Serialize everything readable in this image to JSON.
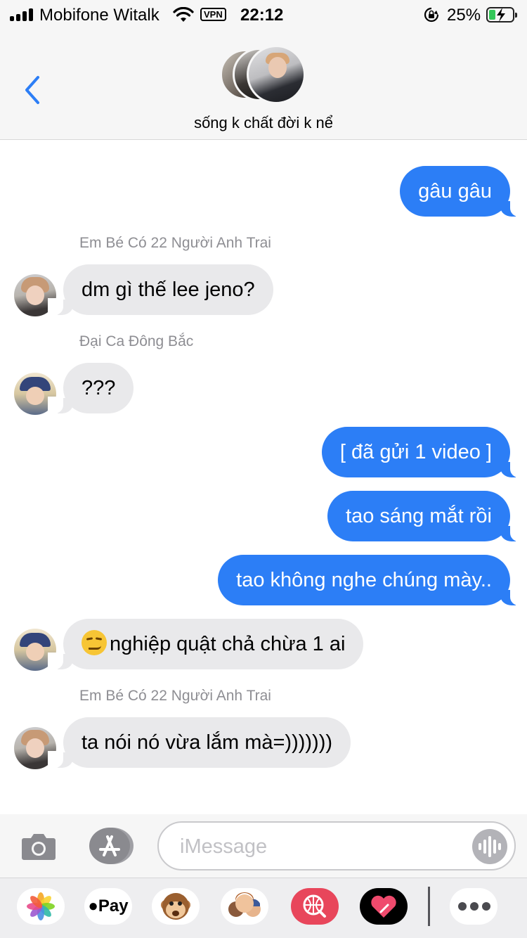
{
  "status_bar": {
    "carrier": "Mobifone Witalk",
    "vpn": "VPN",
    "time": "22:12",
    "battery": "25%",
    "battery_level": 0.25
  },
  "header": {
    "title": "sống k chất đời k nể"
  },
  "messages": [
    {
      "text": "gâu gâu"
    },
    {
      "sender": "Em Bé Có 22 Người Anh Trai",
      "text": "dm gì thế lee jeno?"
    },
    {
      "sender": "Đại Ca Đông Bắc",
      "text": "???"
    },
    {
      "text": "[ đã gửi 1 video ]"
    },
    {
      "text": "tao sáng mắt rồi"
    },
    {
      "text": "tao không nghe chúng mày.."
    },
    {
      "text": "nghiệp quật chả chừa 1 ai",
      "emoji": "smirking-face"
    },
    {
      "sender": "Em Bé Có 22 Người Anh Trai",
      "text": "ta nói nó vừa lắm mà=)))))))"
    }
  ],
  "compose": {
    "placeholder": "iMessage"
  },
  "drawer": {
    "pay_label": "Pay"
  },
  "colors": {
    "outgoing_bubble": "#2c7ef6",
    "incoming_bubble": "#e9e9eb",
    "accent": "#2c7ef6"
  },
  "icons": [
    "signal-icon",
    "wifi-icon",
    "rotation-lock-icon",
    "battery-icon",
    "back-chevron-icon",
    "camera-icon",
    "app-store-icon",
    "audio-waveform-icon",
    "photos-icon",
    "apple-pay-icon",
    "monkey-icon",
    "memoji-icon",
    "image-search-icon",
    "digital-touch-icon",
    "more-icon"
  ]
}
